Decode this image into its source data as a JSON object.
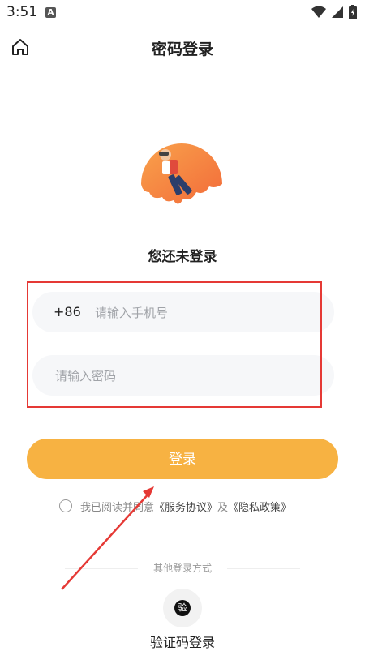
{
  "status_bar": {
    "time": "3:51",
    "notification_letter": "A"
  },
  "header": {
    "title": "密码登录",
    "home_icon": "home-icon"
  },
  "profile": {
    "status_text": "您还未登录"
  },
  "form": {
    "country_code": "+86",
    "phone_placeholder": "请输入手机号",
    "password_placeholder": "请输入密码"
  },
  "login_button_label": "登录",
  "agreement": {
    "prefix": "我已阅读并同意",
    "service_link": "《服务协议》",
    "and": "及",
    "privacy_link": "《隐私政策》"
  },
  "other_login": {
    "divider_text": "其他登录方式",
    "code_icon_text": "验",
    "code_login_label": "验证码登录"
  },
  "colors": {
    "accent": "#f7b242",
    "annotation": "#e53935"
  }
}
